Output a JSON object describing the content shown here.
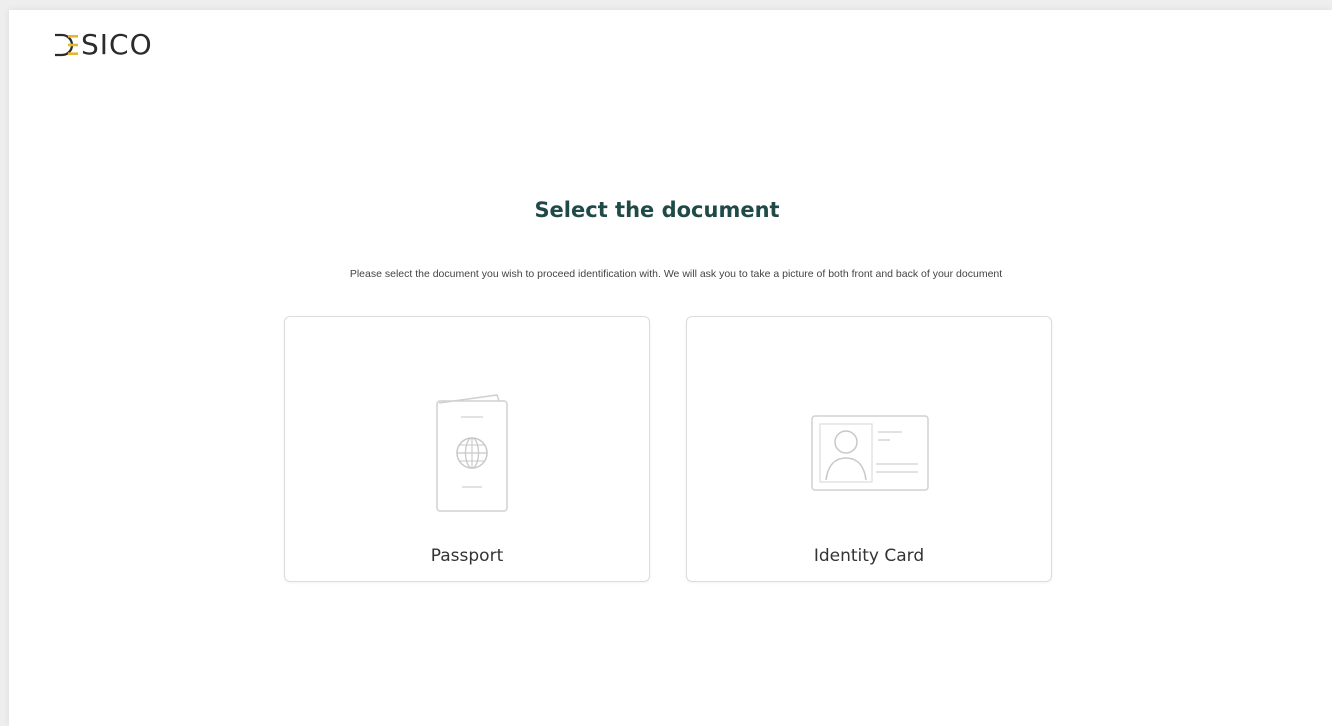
{
  "brand": {
    "logo_text": "SICO",
    "accent_color": "#e5b72e",
    "dark_color": "#2b2b2b"
  },
  "main": {
    "title": "Select the document",
    "description": "Please select the document you wish to proceed identification with. We will ask you to take a picture of both front and back of your document"
  },
  "options": [
    {
      "label": "Passport",
      "icon": "passport-icon"
    },
    {
      "label": "Identity Card",
      "icon": "id-card-icon"
    }
  ],
  "colors": {
    "title": "#1f4a48",
    "card_border": "#dcdcdc",
    "icon_stroke": "#d0d0d0"
  }
}
